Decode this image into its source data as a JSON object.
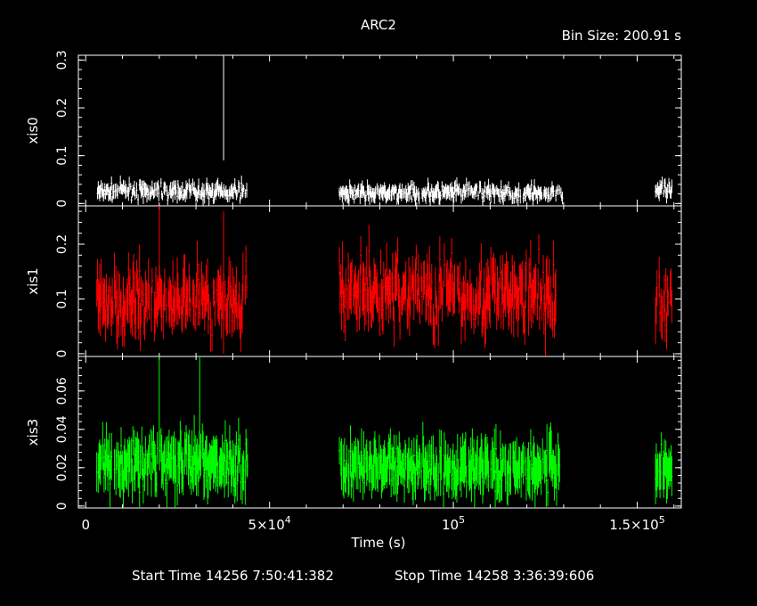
{
  "header": {
    "title": "ARC2",
    "bin_size": "Bin Size: 200.91 s"
  },
  "footer": {
    "start_time": "Start Time 14256  7:50:41:382",
    "stop_time": "Stop Time 14258  3:36:39:606"
  },
  "colors": {
    "background": "#000000",
    "axes": "#ffffff",
    "xis0": "#ffffff",
    "xis1": "#ff0000",
    "xis3": "#00ff00"
  },
  "chart_data": {
    "type": "scatter",
    "title": "ARC2",
    "xlabel": "Time (s)",
    "xlim": [
      -2000,
      162000
    ],
    "x_ticks": [
      {
        "value": 0,
        "label": "0"
      },
      {
        "value": 50000,
        "label": "5×10",
        "sup": "4"
      },
      {
        "value": 100000,
        "label": "10",
        "sup": "5"
      },
      {
        "value": 150000,
        "label": "1.5×10",
        "sup": "5"
      }
    ],
    "panels": [
      {
        "name": "xis0",
        "ylabel": "xis0",
        "color": "#ffffff",
        "ylim": [
          -0.005,
          0.31
        ],
        "y_ticks": [
          {
            "value": 0,
            "label": "0"
          },
          {
            "value": 0.1,
            "label": "0.1"
          },
          {
            "value": 0.2,
            "label": "0.2"
          },
          {
            "value": 0.3,
            "label": "0.3"
          }
        ],
        "segments": [
          {
            "x_start": 3000,
            "x_end": 44000,
            "mean": 0.025,
            "spread": 0.012,
            "err": 0.012
          },
          {
            "x_start": 69000,
            "x_end": 130000,
            "mean": 0.022,
            "spread": 0.012,
            "err": 0.012
          },
          {
            "x_start": 155000,
            "x_end": 159500,
            "mean": 0.025,
            "spread": 0.012,
            "err": 0.012
          }
        ],
        "spikes": [
          {
            "x": 37500,
            "y": 0.2,
            "err": 0.11
          }
        ]
      },
      {
        "name": "xis1",
        "ylabel": "xis1",
        "color": "#ff0000",
        "ylim": [
          -0.005,
          0.27
        ],
        "y_ticks": [
          {
            "value": 0,
            "label": "0"
          },
          {
            "value": 0.1,
            "label": "0.1"
          },
          {
            "value": 0.2,
            "label": "0.2"
          }
        ],
        "segments": [
          {
            "x_start": 3000,
            "x_end": 44000,
            "mean": 0.1,
            "spread": 0.045,
            "err": 0.035
          },
          {
            "x_start": 69000,
            "x_end": 128000,
            "mean": 0.11,
            "spread": 0.05,
            "err": 0.035
          },
          {
            "x_start": 155000,
            "x_end": 159500,
            "mean": 0.09,
            "spread": 0.04,
            "err": 0.035
          }
        ],
        "spikes": [
          {
            "x": 37500,
            "y": 0.13,
            "err": 0.13
          },
          {
            "x": 20000,
            "y": 0.2,
            "err": 0.07
          }
        ]
      },
      {
        "name": "xis3",
        "ylabel": "xis3",
        "color": "#00ff00",
        "ylim": [
          -0.001,
          0.078
        ],
        "y_ticks": [
          {
            "value": 0,
            "label": "0"
          },
          {
            "value": 0.02,
            "label": "0.02"
          },
          {
            "value": 0.04,
            "label": "0.04"
          },
          {
            "value": 0.06,
            "label": "0.06"
          }
        ],
        "segments": [
          {
            "x_start": 3000,
            "x_end": 44000,
            "mean": 0.022,
            "spread": 0.009,
            "err": 0.01
          },
          {
            "x_start": 69000,
            "x_end": 129000,
            "mean": 0.02,
            "spread": 0.009,
            "err": 0.01
          },
          {
            "x_start": 155000,
            "x_end": 159500,
            "mean": 0.02,
            "spread": 0.009,
            "err": 0.01
          }
        ],
        "spikes": [
          {
            "x": 20000,
            "y": 0.05,
            "err": 0.028
          },
          {
            "x": 31000,
            "y": 0.05,
            "err": 0.028
          }
        ]
      }
    ]
  }
}
